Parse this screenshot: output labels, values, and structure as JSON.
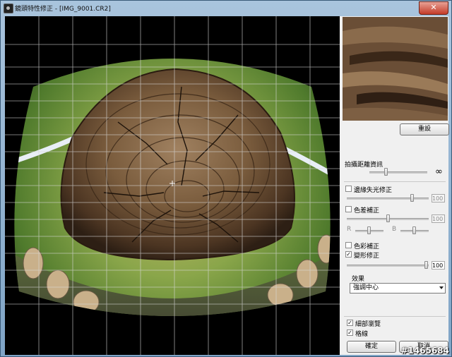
{
  "window": {
    "title": "鏡頭特性修正 - [IMG_9001.CR2]",
    "close_icon": "close-icon-x",
    "app_icon": "camera-icon"
  },
  "panel": {
    "reset_button": "重設",
    "shooting_distance": {
      "label": "拍攝距離資訊",
      "infinity_symbol": "∞",
      "level": 0.45
    },
    "peripheral_illumination": {
      "label": "邊緣失光修正",
      "checked": false,
      "value": "100"
    },
    "chromatic_aberration": {
      "label": "色差補正",
      "checked": false,
      "value": "100",
      "r_label": "R",
      "b_label": "B"
    },
    "color_blur": {
      "label": "色彩補正",
      "checked": false
    },
    "distortion": {
      "label": "變形修正",
      "checked": true,
      "value": "100"
    },
    "effect": {
      "label": "效果",
      "selected": "強調中心"
    },
    "detail_view": {
      "label": "細部瀏覽",
      "checked": true
    },
    "grid": {
      "label": "格線",
      "checked": true
    },
    "ok_button": "確定",
    "cancel_button": "取消"
  },
  "watermark": "#1465684",
  "colors": {
    "image_background": "#000000",
    "panel_background": "#f0f0f0",
    "close_button": "#c43b28"
  }
}
